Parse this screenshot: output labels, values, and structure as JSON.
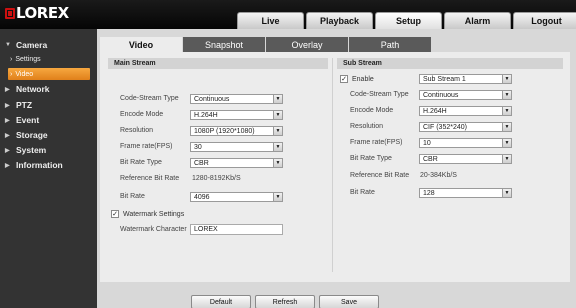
{
  "brand": {
    "logo_text": "LOREX"
  },
  "topnav": [
    {
      "label": "Live",
      "active": false
    },
    {
      "label": "Playback",
      "active": false
    },
    {
      "label": "Setup",
      "active": true
    },
    {
      "label": "Alarm",
      "active": false
    },
    {
      "label": "Logout",
      "active": false
    }
  ],
  "sidebar": {
    "items": [
      {
        "label": "Camera",
        "expanded": true
      },
      {
        "label": "Network"
      },
      {
        "label": "PTZ"
      },
      {
        "label": "Event"
      },
      {
        "label": "Storage"
      },
      {
        "label": "System"
      },
      {
        "label": "Information"
      }
    ],
    "sub_items": [
      {
        "label": "Settings",
        "active": false
      },
      {
        "label": "Video",
        "active": true
      }
    ]
  },
  "tabs": [
    {
      "label": "Video",
      "active": true
    },
    {
      "label": "Snapshot"
    },
    {
      "label": "Overlay"
    },
    {
      "label": "Path"
    }
  ],
  "main_stream": {
    "title": "Main Stream",
    "code_stream_type": {
      "label": "Code-Stream Type",
      "value": "Continuous"
    },
    "encode_mode": {
      "label": "Encode Mode",
      "value": "H.264H"
    },
    "resolution": {
      "label": "Resolution",
      "value": "1080P (1920*1080)"
    },
    "frame_rate": {
      "label": "Frame rate(FPS)",
      "value": "30"
    },
    "bit_rate_type": {
      "label": "Bit Rate Type",
      "value": "CBR"
    },
    "reference_bit_rate": {
      "label": "Reference Bit Rate",
      "value": "1280-8192Kb/S"
    },
    "bit_rate": {
      "label": "Bit Rate",
      "value": "4096"
    },
    "watermark_settings": {
      "label": "Watermark Settings",
      "checked": true
    },
    "watermark_character": {
      "label": "Watermark Character",
      "value": "LOREX"
    }
  },
  "sub_stream": {
    "title": "Sub Stream",
    "enable": {
      "label": "Enable",
      "checked": true,
      "value": "Sub Stream 1"
    },
    "code_stream_type": {
      "label": "Code-Stream Type",
      "value": "Continuous"
    },
    "encode_mode": {
      "label": "Encode Mode",
      "value": "H.264H"
    },
    "resolution": {
      "label": "Resolution",
      "value": "CIF (352*240)"
    },
    "frame_rate": {
      "label": "Frame rate(FPS)",
      "value": "10"
    },
    "bit_rate_type": {
      "label": "Bit Rate Type",
      "value": "CBR"
    },
    "reference_bit_rate": {
      "label": "Reference Bit Rate",
      "value": "20-384Kb/S"
    },
    "bit_rate": {
      "label": "Bit Rate",
      "value": "128"
    }
  },
  "buttons": {
    "default": "Default",
    "refresh": "Refresh",
    "save": "Save"
  },
  "check_glyph": "✓",
  "dropdown_glyph": "▼",
  "colors": {
    "accent": "#f0901e",
    "brand_red": "#cc1010"
  }
}
